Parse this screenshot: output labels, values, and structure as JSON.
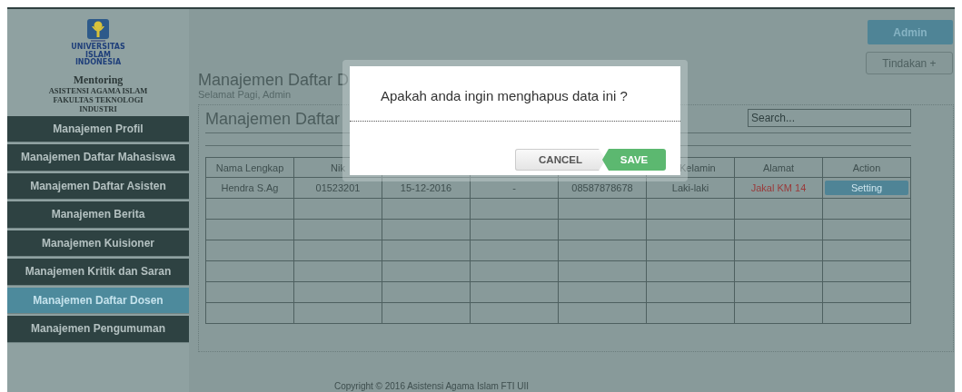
{
  "logo": {
    "lines": [
      "UNIVERSITAS",
      "ISLAM",
      "INDONESIA"
    ]
  },
  "brand": {
    "title": "Mentoring",
    "subtitle_lines": [
      "ASISTENSI AGAMA ISLAM",
      "FAKULTAS TEKNOLOGI",
      "INDUSTRI"
    ]
  },
  "sidebar": {
    "items": [
      {
        "label": "Manajemen Profil",
        "selected": false
      },
      {
        "label": "Manajemen Daftar Mahasiswa",
        "selected": false
      },
      {
        "label": "Manajemen Daftar Asisten",
        "selected": false
      },
      {
        "label": "Manajemen Berita",
        "selected": false
      },
      {
        "label": "Manajemen Kuisioner",
        "selected": false
      },
      {
        "label": "Manajemen Kritik dan Saran",
        "selected": false
      },
      {
        "label": "Manajemen Daftar Dosen",
        "selected": true
      },
      {
        "label": "Manajemen Pengumuman",
        "selected": false
      }
    ]
  },
  "header": {
    "title": "Manajemen Daftar D",
    "greeting": "Selamat Pagi, Admin",
    "user_button": "Admin",
    "actions_button": "Tindakan +"
  },
  "panel": {
    "title": "Manajemen Daftar",
    "search": {
      "placeholder": "Search..."
    }
  },
  "table": {
    "columns": [
      {
        "label": "Nama Lengkap"
      },
      {
        "label": "Nik"
      },
      {},
      {},
      {},
      {
        "label": "Kelamin"
      },
      {
        "label": "Alamat"
      },
      {
        "label": "Action"
      }
    ],
    "rows": [
      {
        "cells": [
          "Hendra S.Ag",
          "01523201",
          "15-12-2016",
          "-",
          "08587878678",
          "Laki-laki",
          "Jakal KM 14"
        ],
        "action": "Setting"
      }
    ]
  },
  "footer": {
    "copyright": "Copyright © 2016 Asistensi Agama Islam FTI UII"
  },
  "dialog": {
    "message": "Apakah anda ingin menghapus data ini ?",
    "buttons": [
      {
        "label": "CANCEL",
        "kind": "cancel"
      },
      {
        "label": "SAVE",
        "kind": "confirm"
      }
    ]
  }
}
